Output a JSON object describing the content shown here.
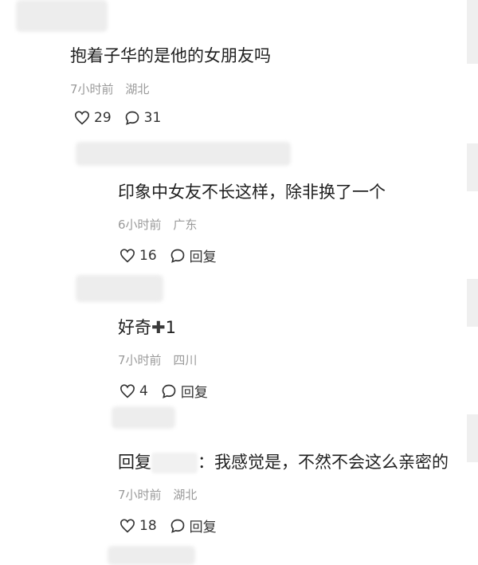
{
  "comments": [
    {
      "text": "抱着子华的是他的女朋友吗",
      "time": "7小时前",
      "location": "湖北",
      "likes": "29",
      "replies": "31"
    },
    {
      "text": "印象中女友不长这样，除非换了一个",
      "time": "6小时前",
      "location": "广东",
      "likes": "16",
      "reply_label": "回复"
    },
    {
      "text_prefix": "好奇",
      "text_suffix": "1",
      "time": "7小时前",
      "location": "四川",
      "likes": "4",
      "reply_label": "回复"
    },
    {
      "text_prefix": "回复",
      "text_suffix": "：我感觉是，不然不会这么亲密的",
      "time": "7小时前",
      "location": "湖北",
      "likes": "18",
      "reply_label": "回复"
    }
  ],
  "icons": {
    "like": "heart-outline-icon",
    "reply": "speech-bubble-icon",
    "plus": "bold-plus-glyph"
  }
}
